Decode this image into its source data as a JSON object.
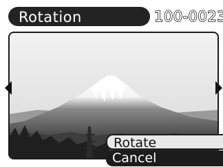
{
  "screen": {
    "title": "Rotation",
    "file_number": "100-0023"
  },
  "image": {
    "subject": "photo-mountain-landscape"
  },
  "nav": {
    "left_icon": "arrow-left-icon",
    "right_icon": "arrow-right-icon"
  },
  "menu": {
    "items": [
      {
        "label": "Rotate",
        "selected": true
      },
      {
        "label": "Cancel",
        "selected": false
      }
    ]
  },
  "colors": {
    "title_bar": "#232323",
    "highlight": "#e9e9e9",
    "menu_dark": "#1c1c1c"
  }
}
